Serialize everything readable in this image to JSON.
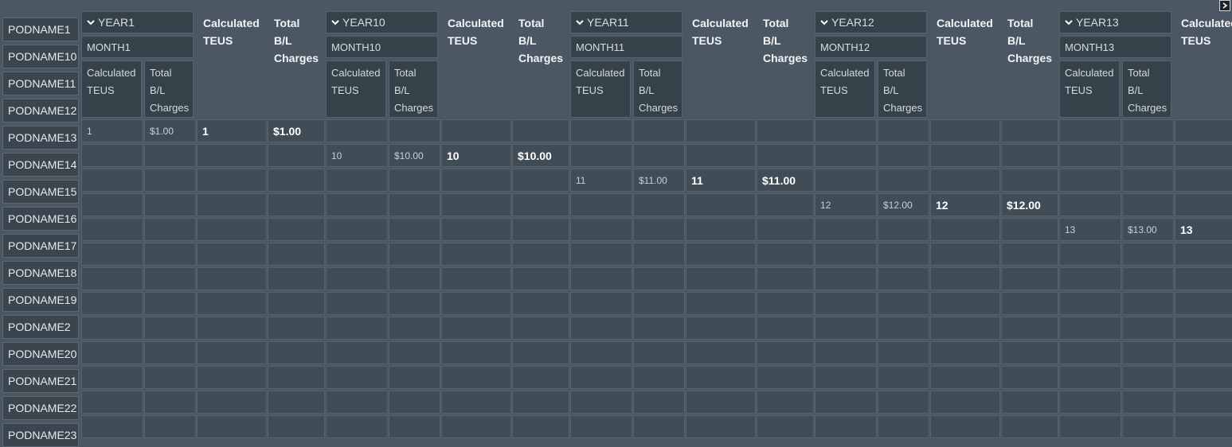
{
  "rows": [
    "PODNAME1",
    "PODNAME10",
    "PODNAME11",
    "PODNAME12",
    "PODNAME13",
    "PODNAME14",
    "PODNAME15",
    "PODNAME16",
    "PODNAME17",
    "PODNAME18",
    "PODNAME19",
    "PODNAME2",
    "PODNAME20",
    "PODNAME21",
    "PODNAME22",
    "PODNAME23"
  ],
  "measure_labels": {
    "teus": "Calculated TEUS",
    "charges": "Total B/L Charges"
  },
  "groups": [
    {
      "year": "YEAR1",
      "month": "MONTH1",
      "teus": "1",
      "charges": "$1.00",
      "total_teus": "1",
      "total_charges": "$1.00"
    },
    {
      "year": "YEAR10",
      "month": "MONTH10",
      "teus": "10",
      "charges": "$10.00",
      "total_teus": "10",
      "total_charges": "$10.00"
    },
    {
      "year": "YEAR11",
      "month": "MONTH11",
      "teus": "11",
      "charges": "$11.00",
      "total_teus": "11",
      "total_charges": "$11.00"
    },
    {
      "year": "YEAR12",
      "month": "MONTH12",
      "teus": "12",
      "charges": "$12.00",
      "total_teus": "12",
      "total_charges": "$12.00"
    },
    {
      "year": "YEAR13",
      "month": "MONTH13",
      "teus": "13",
      "charges": "$13.00",
      "total_teus": "13",
      "total_charges": ""
    }
  ],
  "icons": {
    "expand": "chevron-down-icon",
    "scroll": "chevron-right-icon"
  }
}
